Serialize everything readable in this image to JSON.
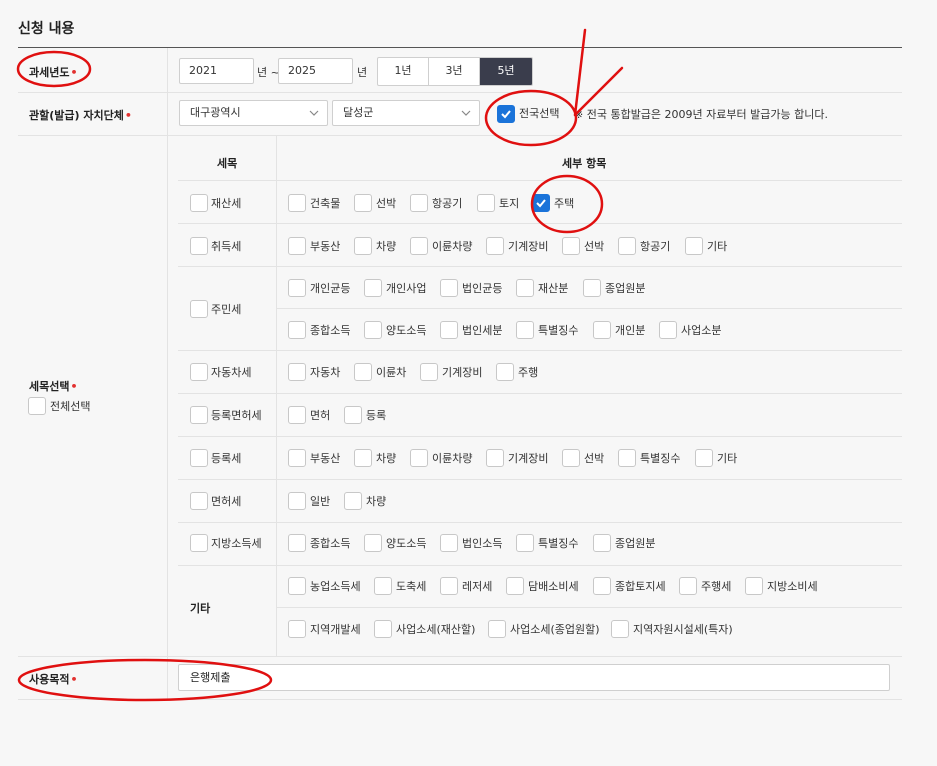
{
  "section": {
    "title": "신청 내용"
  },
  "tax_year": {
    "label": "과세년도",
    "from": "2021",
    "from_suffix": "년 ~",
    "to": "2025",
    "to_suffix": "년",
    "ranges": [
      "1년",
      "3년",
      "5년"
    ],
    "selected_range": "5년"
  },
  "authority": {
    "label": "관할(발급) 자치단체",
    "city": "대구광역시",
    "district": "달성군",
    "nationwide_label": "전국선택",
    "nationwide_checked": true,
    "note": "※ 전국 통합발급은 2009년 자료부터 발급가능 합니다."
  },
  "tax_items": {
    "label": "세목선택",
    "select_all": "전체선택",
    "col_tax": "세목",
    "col_detail": "세부 항목",
    "rows": [
      {
        "name": "재산세",
        "items": [
          "건축물",
          "선박",
          "항공기",
          "토지",
          "주택"
        ],
        "checked": [
          "주택"
        ]
      },
      {
        "name": "취득세",
        "items": [
          "부동산",
          "차량",
          "이륜차량",
          "기계장비",
          "선박",
          "항공기",
          "기타"
        ]
      },
      {
        "name": "주민세",
        "items": [
          "개인균등",
          "개인사업",
          "법인균등",
          "재산분",
          "종업원분"
        ],
        "items2": [
          "종합소득",
          "양도소득",
          "법인세분",
          "특별징수",
          "개인분",
          "사업소분"
        ]
      },
      {
        "name": "자동차세",
        "items": [
          "자동차",
          "이륜차",
          "기계장비",
          "주행"
        ]
      },
      {
        "name": "등록면허세",
        "items": [
          "면허",
          "등록"
        ]
      },
      {
        "name": "등록세",
        "items": [
          "부동산",
          "차량",
          "이륜차량",
          "기계장비",
          "선박",
          "특별징수",
          "기타"
        ]
      },
      {
        "name": "면허세",
        "items": [
          "일반",
          "차량"
        ]
      },
      {
        "name": "지방소득세",
        "items": [
          "종합소득",
          "양도소득",
          "법인소득",
          "특별징수",
          "종업원분"
        ]
      },
      {
        "name": "기타",
        "items": [
          "농업소득세",
          "도축세",
          "레저세",
          "담배소비세",
          "종합토지세",
          "주행세",
          "지방소비세"
        ],
        "items2": [
          "지역개발세",
          "사업소세(재산할)",
          "사업소세(종업원할)",
          "지역자원시설세(특자)"
        ]
      }
    ]
  },
  "purpose": {
    "label": "사용목적",
    "value": "은행제출"
  },
  "colors": {
    "accent": "#1a73d9",
    "active_button": "#3a3d4c",
    "required": "#e2312f",
    "annotation": "#e01010"
  }
}
